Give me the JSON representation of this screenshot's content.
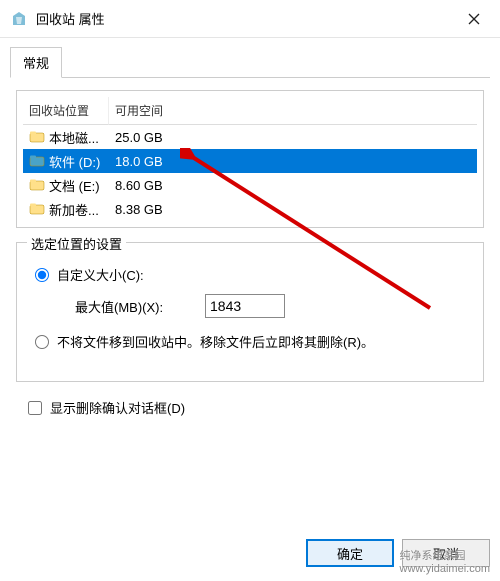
{
  "titlebar": {
    "title": "回收站 属性"
  },
  "tabs": {
    "general": "常规"
  },
  "columns": {
    "location": "回收站位置",
    "space": "可用空间"
  },
  "rows": [
    {
      "location": "本地磁...",
      "space": "25.0 GB",
      "icon_fill": "#ffe08a",
      "selected": false
    },
    {
      "location": "软件 (D:)",
      "space": "18.0 GB",
      "icon_fill": "#4aa3c7",
      "selected": true
    },
    {
      "location": "文档 (E:)",
      "space": "8.60 GB",
      "icon_fill": "#ffe08a",
      "selected": false
    },
    {
      "location": "新加卷...",
      "space": "8.38 GB",
      "icon_fill": "#ffe08a",
      "selected": false
    }
  ],
  "group": {
    "label": "选定位置的设置",
    "custom_size_label": "自定义大小(C):",
    "max_label": "最大值(MB)(X):",
    "max_value": "1843",
    "no_recycle_label": "不将文件移到回收站中。移除文件后立即将其删除(R)。"
  },
  "checkbox": {
    "label": "显示删除确认对话框(D)"
  },
  "buttons": {
    "ok": "确定",
    "cancel": "取消"
  },
  "watermark": {
    "line1": "纯净系统家园",
    "line2": "www.yidaimei.com"
  }
}
